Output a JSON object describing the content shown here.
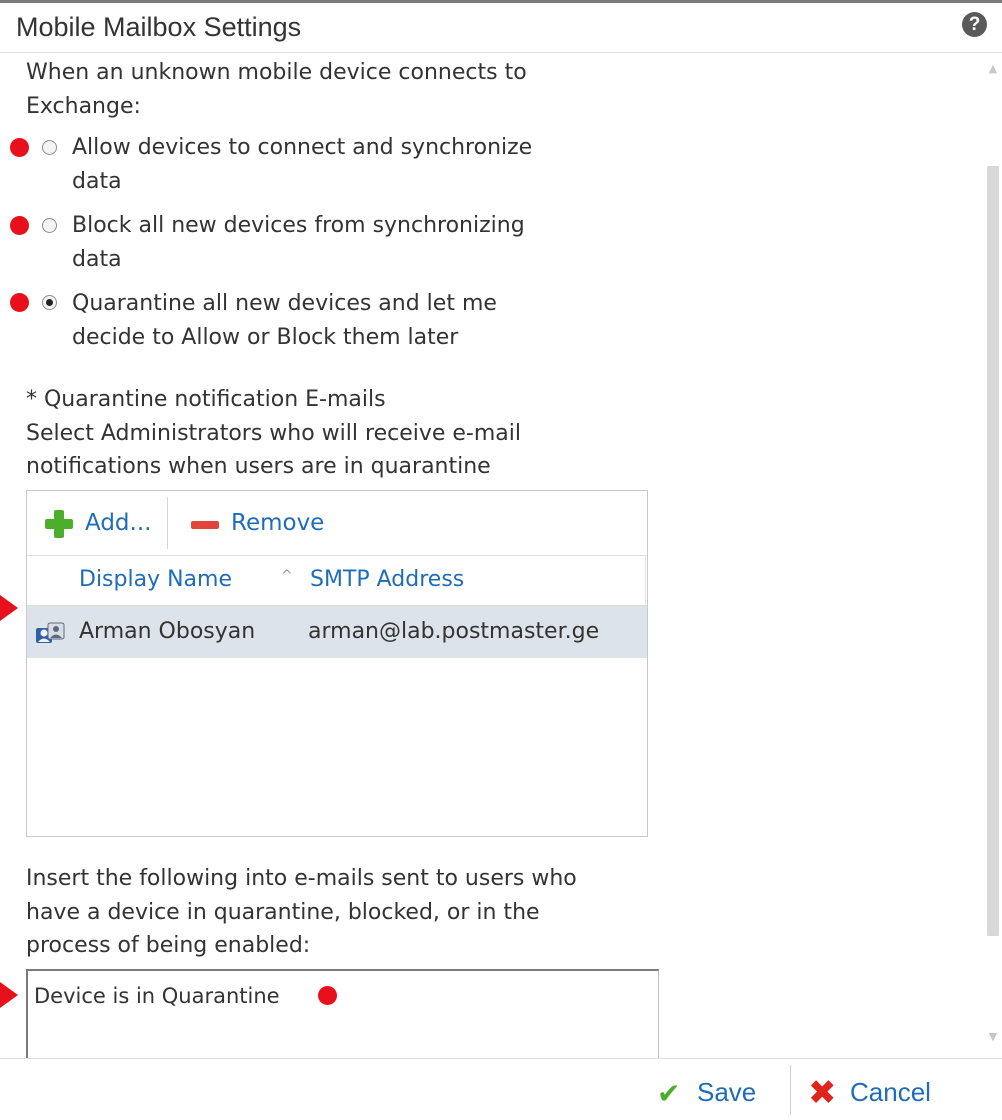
{
  "dialog": {
    "title": "Mobile Mailbox Settings",
    "help_symbol": "?"
  },
  "access": {
    "intro_line1": "When an unknown mobile device connects to",
    "intro_line2": "Exchange:",
    "options": [
      {
        "line1": "Allow devices to connect and synchronize",
        "line2": "data",
        "selected": false
      },
      {
        "line1": "Block all new devices from synchronizing",
        "line2": "data",
        "selected": false
      },
      {
        "line1": "Quarantine all new devices and let me",
        "line2": "decide to Allow or Block them later",
        "selected": true
      }
    ]
  },
  "quarantine": {
    "heading": "* Quarantine notification E-mails",
    "desc_line1": "Select Administrators who will receive e-mail",
    "desc_line2": "notifications when users are in quarantine",
    "add_label": "Add...",
    "remove_label": "Remove",
    "columns": [
      "Display Name",
      "SMTP Address"
    ],
    "rows": [
      {
        "display_name": "Arman Obosyan",
        "smtp": "arman@lab.postmaster.ge"
      }
    ]
  },
  "email_text": {
    "label_line1": "Insert the following into e-mails sent to users who",
    "label_line2": "have a device in quarantine, blocked, or in the",
    "label_line3": "process of being enabled:",
    "value": "Device is in Quarantine"
  },
  "footer": {
    "save_label": "Save",
    "cancel_label": "Cancel"
  },
  "icons": {
    "help": "help-icon",
    "add": "plus-icon",
    "remove": "minus-icon",
    "sort": "sort-ascending-icon",
    "user": "user-icon",
    "save": "checkmark-icon",
    "cancel": "x-icon"
  },
  "colors": {
    "link_blue": "#1f6db8",
    "annotation_red": "#e8111b",
    "selected_row": "#dde3ea",
    "add_green": "#4dae2c"
  }
}
